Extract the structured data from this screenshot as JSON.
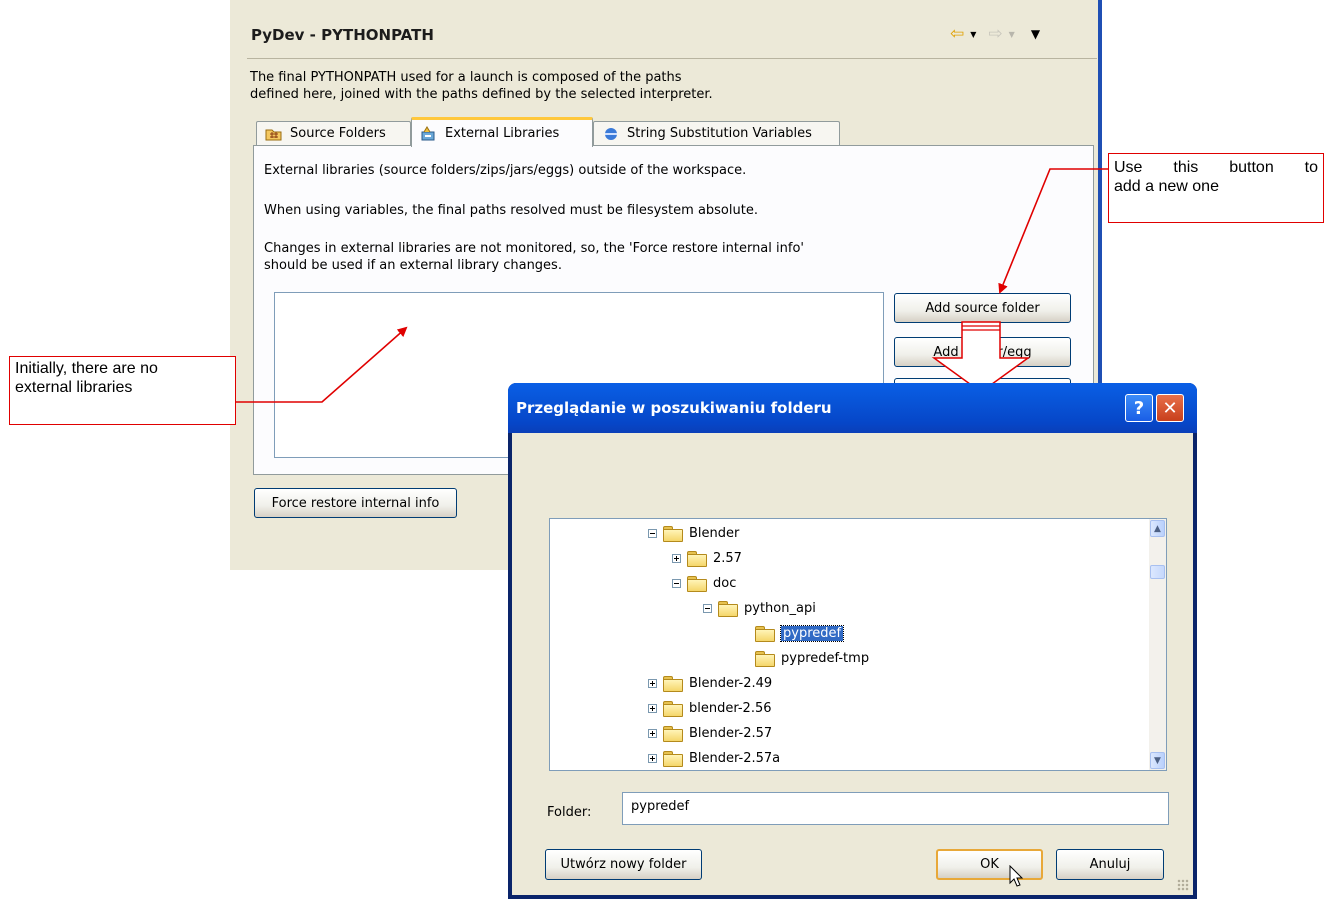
{
  "panel": {
    "title": "PyDev - PYTHONPATH",
    "description": [
      "The final PYTHONPATH used for a launch is composed of the paths",
      "defined here, joined with the paths defined by the selected interpreter."
    ],
    "tabs": [
      {
        "label": "Source Folders",
        "icon": "source-folder-icon",
        "active": false
      },
      {
        "label": "External Libraries",
        "icon": "library-icon",
        "active": true
      },
      {
        "label": "String Substitution Variables",
        "icon": "variable-icon",
        "active": false
      }
    ],
    "content_lines": [
      "External libraries (source folders/zips/jars/eggs) outside of the workspace.",
      "When using variables, the final paths resolved must be filesystem absolute.",
      "Changes in external libraries are not monitored, so, the 'Force restore internal info'",
      "should be used if an external library changes."
    ],
    "buttons": {
      "add_source_folder": "Add source folder",
      "add_zip_egg": "Add zip/jar/egg",
      "force_restore": "Force restore internal info"
    },
    "nav_icons": [
      "back-arrow-icon",
      "forward-arrow-icon",
      "view-menu-icon"
    ]
  },
  "dialog": {
    "title": "Przeglądanie w poszukiwaniu folderu",
    "help_glyph": "?",
    "close_glyph": "✕",
    "tree": [
      {
        "label": "Blender",
        "level": 0,
        "expander": "minus",
        "selected": false
      },
      {
        "label": "2.57",
        "level": 1,
        "expander": "plus",
        "selected": false
      },
      {
        "label": "doc",
        "level": 1,
        "expander": "minus",
        "selected": false
      },
      {
        "label": "python_api",
        "level": 2,
        "expander": "minus",
        "selected": false
      },
      {
        "label": "pypredef",
        "level": 3,
        "expander": "none",
        "selected": true
      },
      {
        "label": "pypredef-tmp",
        "level": 3,
        "expander": "none",
        "selected": false
      },
      {
        "label": "Blender-2.49",
        "level": 0,
        "expander": "plus",
        "selected": false
      },
      {
        "label": "blender-2.56",
        "level": 0,
        "expander": "plus",
        "selected": false
      },
      {
        "label": "Blender-2.57",
        "level": 0,
        "expander": "plus",
        "selected": false
      },
      {
        "label": "Blender-2.57a",
        "level": 0,
        "expander": "plus",
        "selected": false
      }
    ],
    "folder_label": "Folder:",
    "folder_value": "pypredef",
    "buttons": {
      "new_folder": "Utwórz nowy folder",
      "ok": "OK",
      "cancel": "Anuluj"
    }
  },
  "annotations": {
    "left_callout": [
      "Initially, there are no",
      "external libraries"
    ],
    "right_callout": [
      "Use this button to",
      "add a new one"
    ],
    "color": "#e00000"
  },
  "colors": {
    "panel_bg": "#ece9d8",
    "titlebar": "#0853d6",
    "selection": "#316ac5",
    "active_tab_accent": "#ffc83c"
  }
}
